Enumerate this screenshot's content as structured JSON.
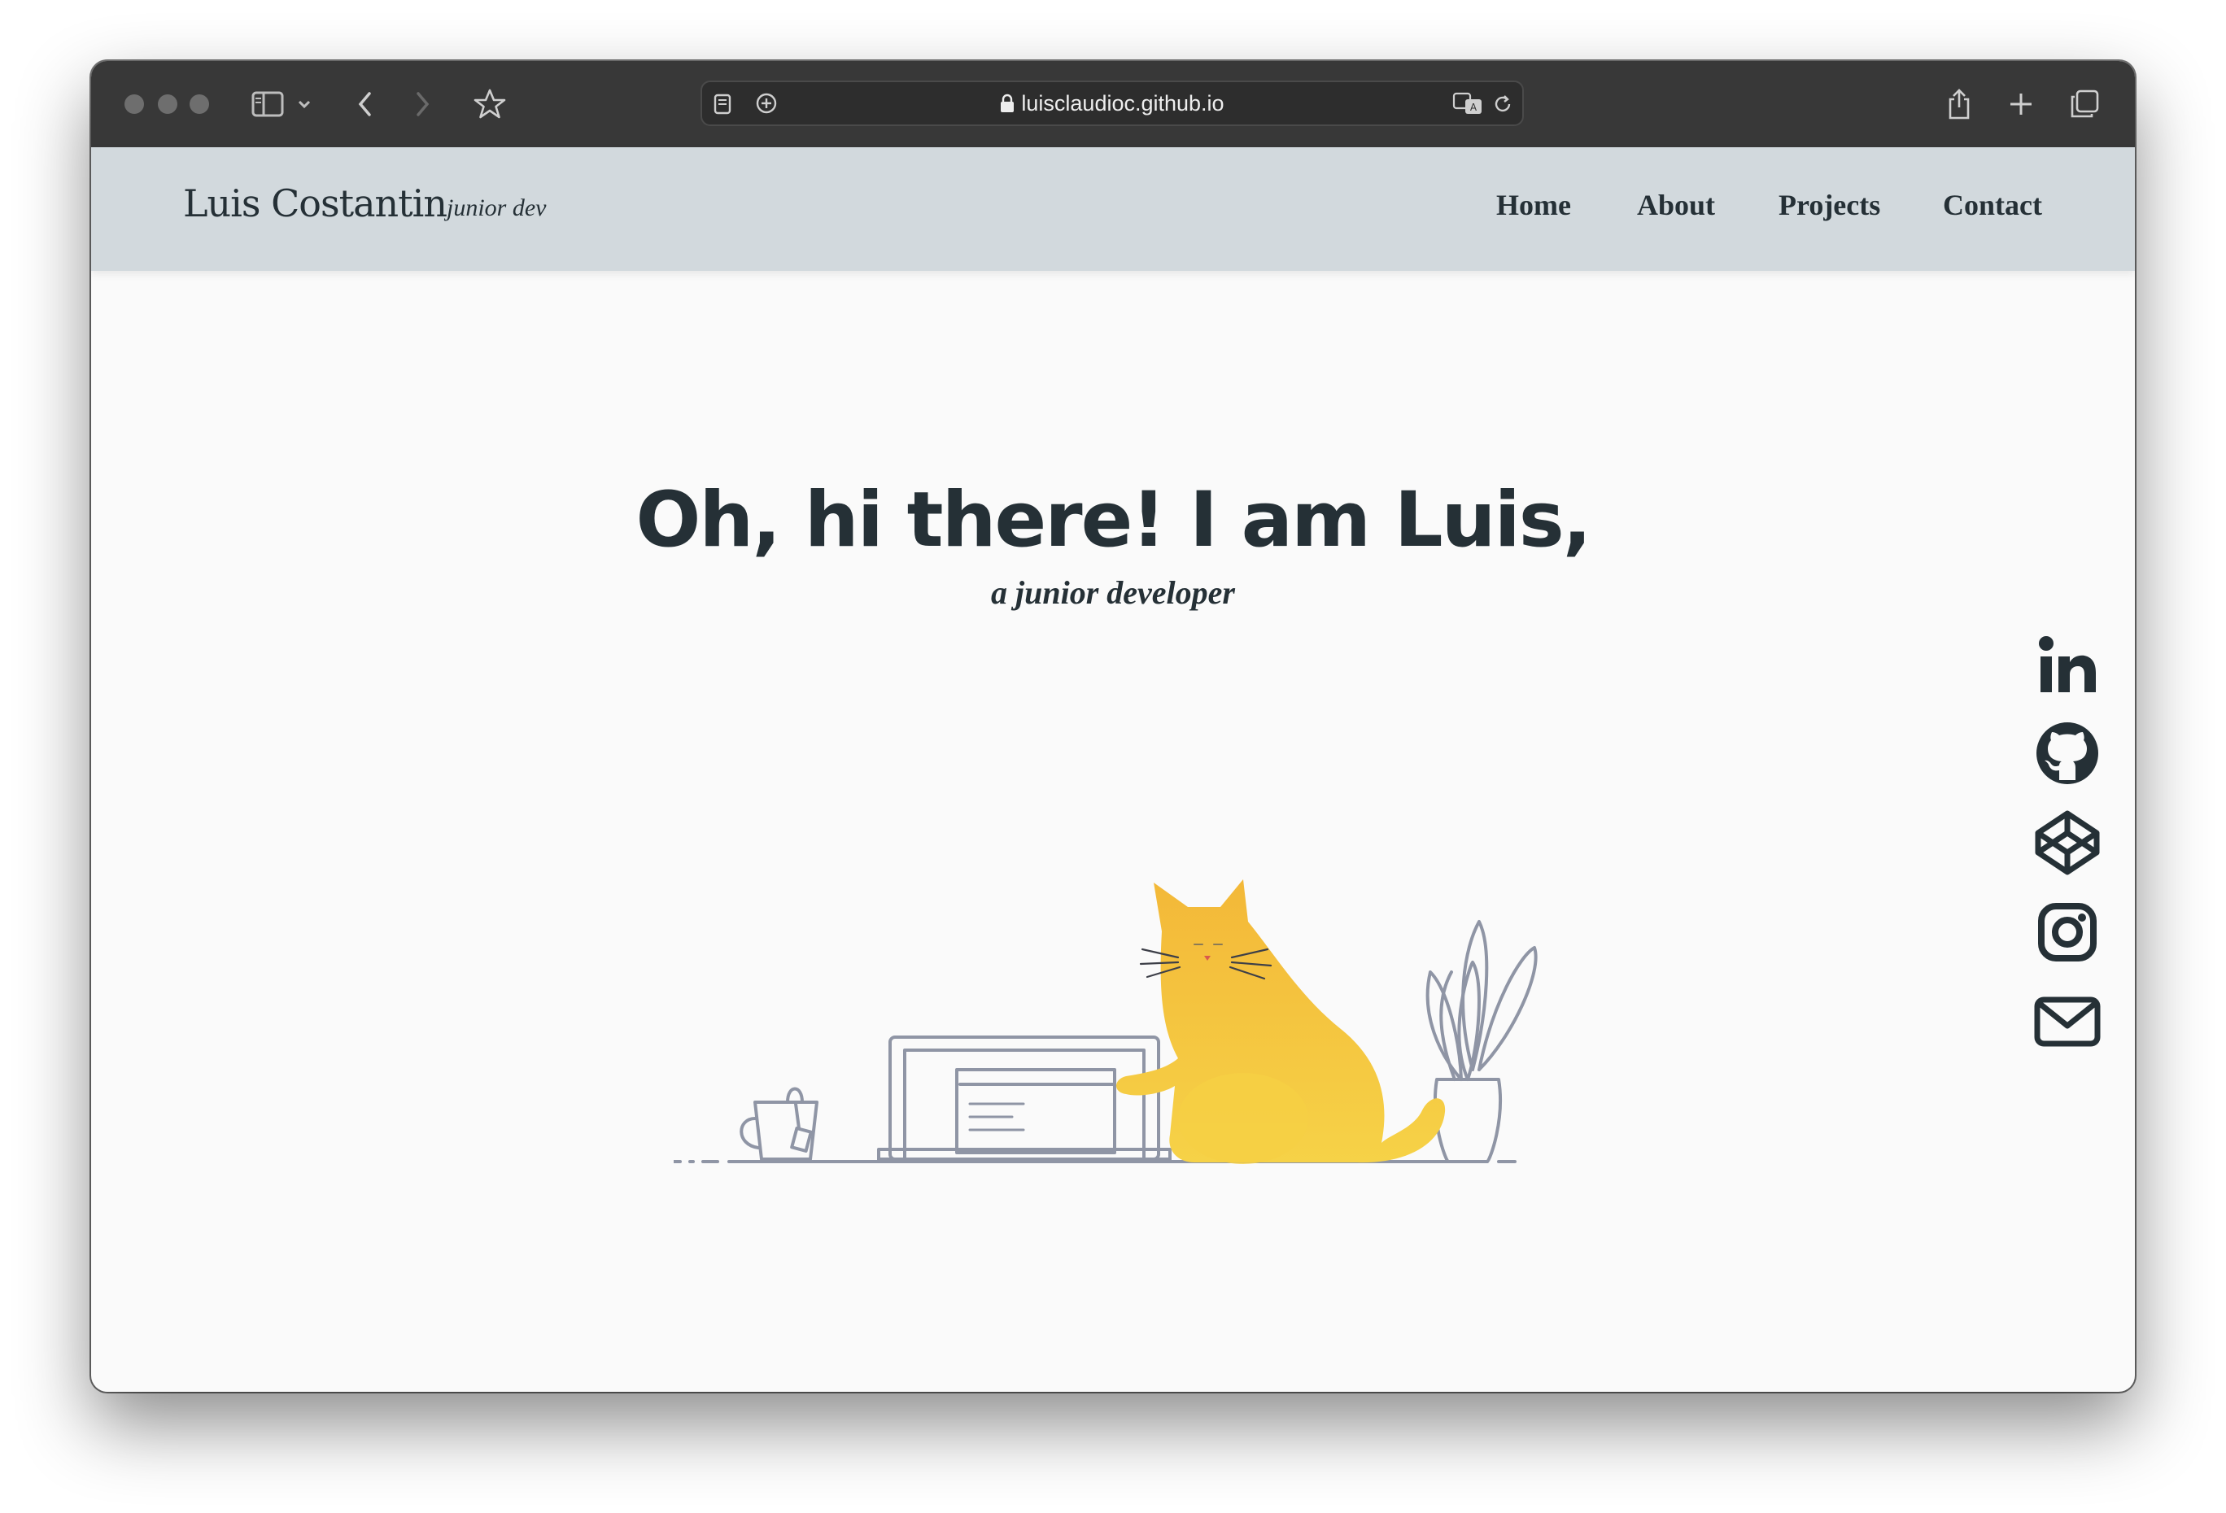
{
  "browser": {
    "url": "luisclaudioc.github.io"
  },
  "site": {
    "brand": "Luis Costantin",
    "tagline": "junior dev",
    "nav": [
      {
        "label": "Home"
      },
      {
        "label": "About"
      },
      {
        "label": "Projects"
      },
      {
        "label": "Contact"
      }
    ]
  },
  "hero": {
    "title": "Oh, hi there! I am Luis,",
    "subtitle": "a junior developer"
  },
  "social": [
    {
      "icon": "linkedin-icon"
    },
    {
      "icon": "github-icon"
    },
    {
      "icon": "codepen-icon"
    },
    {
      "icon": "instagram-icon"
    },
    {
      "icon": "mail-icon"
    }
  ],
  "colors": {
    "text": "#253036",
    "navbar_bg": "#d2d9dd",
    "page_bg": "#fafafa",
    "cat": "#f2be3a"
  }
}
